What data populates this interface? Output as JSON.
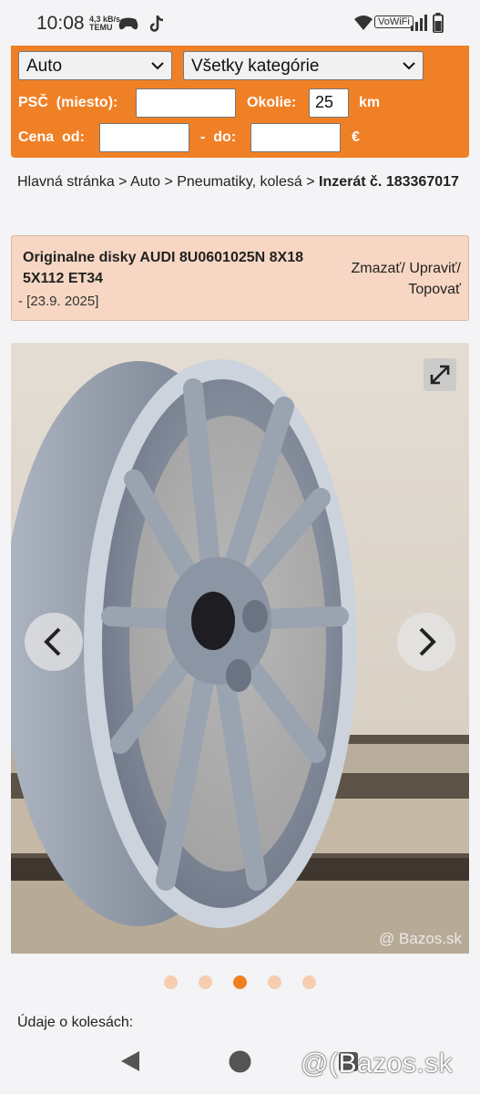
{
  "status_bar": {
    "time": "10:08",
    "mini_text": [
      "4,3 kB/s",
      "TEMU"
    ],
    "vowifi_label": "VoWiFi",
    "icons": [
      "gamepad-icon",
      "tiktok-icon",
      "wifi-icon",
      "signal-icon",
      "battery-icon"
    ]
  },
  "search": {
    "category_select": "Auto",
    "subcategory_select": "Všetky kategórie",
    "psc_label": "PSČ  (miesto):",
    "psc_value": "",
    "okolie_label": "Okolie:",
    "okolie_value": "25",
    "okolie_unit": "km",
    "cena_label": "Cena  od:",
    "cena_od_value": "",
    "cena_sep": "-  do:",
    "cena_do_value": "",
    "currency": "€"
  },
  "breadcrumb": {
    "home": "Hlavná stránka",
    "auto": "Auto",
    "category": "Pneumatiky, kolesá",
    "current": "Inzerát č. 183367017",
    "separator": " > "
  },
  "listing": {
    "title": "Originalne disky AUDI 8U0601025N 8X18 5X112 ET34",
    "date": "- [23.9. 2025]",
    "actions": "Zmazať/ Upraviť/ Topovať"
  },
  "photo": {
    "watermark": "@ Bazos.sk",
    "current_index": 3,
    "total": 5
  },
  "section_heading": "Údaje o kolesách:",
  "nav_bar": {
    "brand": "@(Bazos.sk"
  },
  "colors": {
    "accent": "#f08025",
    "listing_bg": "#f7d7c3",
    "dot_inactive": "#f6cdb0",
    "dot_active": "#f07f20"
  }
}
